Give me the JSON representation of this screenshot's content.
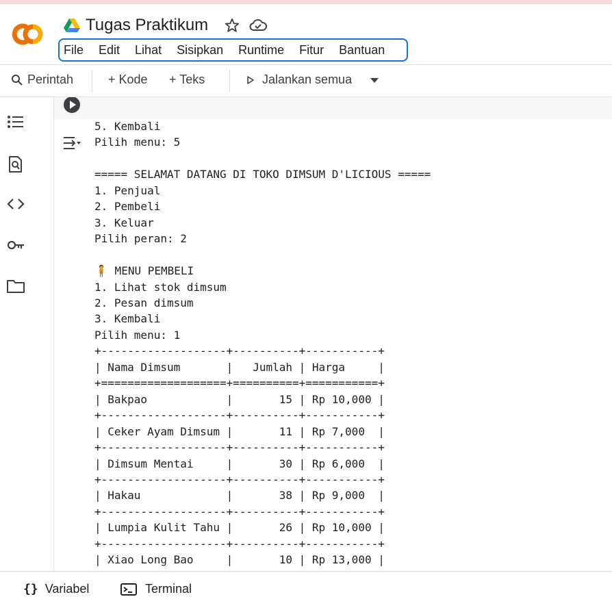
{
  "app": {
    "doc_title": "Tugas Praktikum",
    "logo_icon": "colab-logo",
    "accent_color": "#1a6ce6",
    "logo_colors": [
      "#e8710a",
      "#f9ab00"
    ]
  },
  "menu": {
    "items": [
      "File",
      "Edit",
      "Lihat",
      "Sisipkan",
      "Runtime",
      "Fitur",
      "Bantuan"
    ]
  },
  "toolbar": {
    "command_label": "Perintah",
    "add_code_label": "+ Kode",
    "add_text_label": "+ Teks",
    "run_all_label": "Jalankan semua"
  },
  "sidebar": {
    "icons": [
      "toc-icon",
      "find-icon",
      "code-snippets-icon",
      "secrets-key-icon",
      "folder-icon"
    ]
  },
  "output": {
    "lines": [
      "5. Kembali",
      "Pilih menu: 5",
      "",
      "===== SELAMAT DATANG DI TOKO DIMSUM D'LICIOUS =====",
      "1. Penjual",
      "2. Pembeli",
      "3. Keluar",
      "Pilih peran: 2",
      "",
      "🧍 MENU PEMBELI",
      "1. Lihat stok dimsum",
      "2. Pesan dimsum",
      "3. Kembali",
      "Pilih menu: 1",
      "+-------------------+----------+-----------+",
      "| Nama Dimsum       |   Jumlah | Harga     |",
      "+===================+==========+===========+",
      "| Bakpao            |       15 | Rp 10,000 |",
      "+-------------------+----------+-----------+",
      "| Ceker Ayam Dimsum |       11 | Rp 7,000  |",
      "+-------------------+----------+-----------+",
      "| Dimsum Mentai     |       30 | Rp 6,000  |",
      "+-------------------+----------+-----------+",
      "| Hakau             |       38 | Rp 9,000  |",
      "+-------------------+----------+-----------+",
      "| Lumpia Kulit Tahu |       26 | Rp 10,000 |",
      "+-------------------+----------+-----------+",
      "| Xiao Long Bao     |       10 | Rp 13,000 |"
    ]
  },
  "bottombar": {
    "variables_label": "Variabel",
    "terminal_label": "Terminal"
  }
}
